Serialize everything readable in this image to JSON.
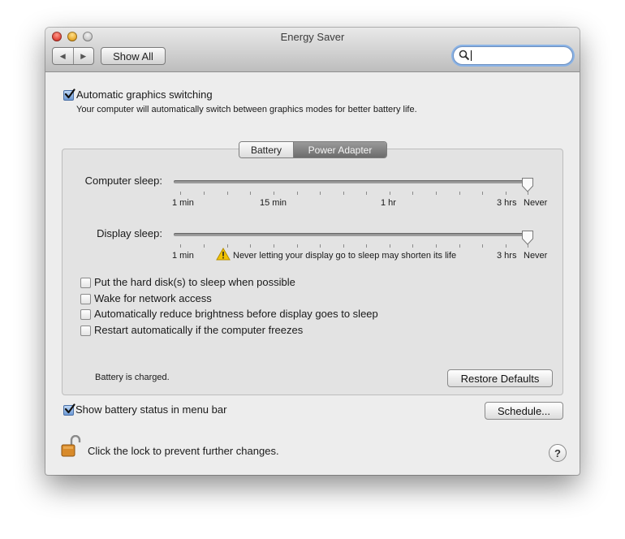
{
  "window": {
    "title": "Energy Saver",
    "nav_back": "◀",
    "nav_forward": "▶",
    "show_all_label": "Show All",
    "search_value": "",
    "search_placeholder": ""
  },
  "graphics": {
    "label": "Automatic graphics switching",
    "checked": true,
    "description": "Your computer will automatically switch between graphics modes for better battery life."
  },
  "tabs": [
    {
      "label": "Battery",
      "selected": false
    },
    {
      "label": "Power Adapter",
      "selected": true
    }
  ],
  "computer_sleep": {
    "label": "Computer sleep:",
    "value": "Never",
    "tick_labels": [
      "1 min",
      "15 min",
      "1 hr",
      "3 hrs",
      "Never"
    ]
  },
  "display_sleep": {
    "label": "Display sleep:",
    "value": "Never",
    "tick_labels": [
      "1 min",
      "3 hrs",
      "Never"
    ],
    "warning": "Never letting your display go to sleep may shorten its life"
  },
  "options": [
    {
      "label": "Put the hard disk(s) to sleep when possible",
      "checked": false
    },
    {
      "label": "Wake for network access",
      "checked": false
    },
    {
      "label": "Automatically reduce brightness before display goes to sleep",
      "checked": false
    },
    {
      "label": "Restart automatically if the computer freezes",
      "checked": false
    }
  ],
  "battery_status": "Battery is charged.",
  "restore_defaults_label": "Restore Defaults",
  "show_battery_status": {
    "label": "Show battery status in menu bar",
    "checked": true
  },
  "schedule_label": "Schedule...",
  "lock_text": "Click the lock to prevent further changes.",
  "help_label": "?",
  "colors": {
    "accent": "#6d9ad6",
    "selected_tab": "#7a7a7a",
    "warning": "#f2c300"
  }
}
